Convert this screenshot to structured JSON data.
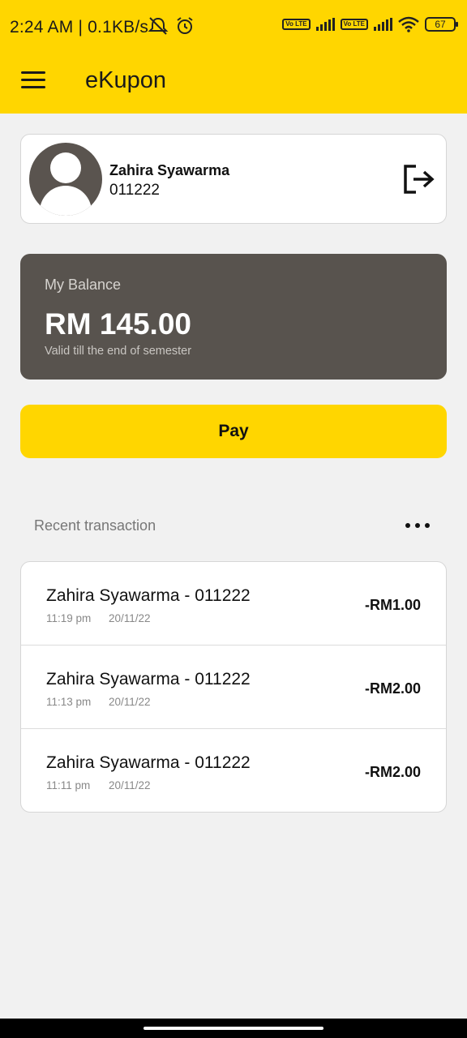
{
  "status_bar": {
    "time": "2:24 AM | 0.1KB/s",
    "network_type": "4G",
    "volte_label": "Vo LTE",
    "battery": "67"
  },
  "app_bar": {
    "title": "eKupon",
    "menu_icon": "hamburger-icon"
  },
  "profile": {
    "name": "Zahira Syawarma",
    "id": "011222",
    "logout_icon": "logout-icon"
  },
  "balance": {
    "label": "My Balance",
    "amount": "RM 145.00",
    "note": "Valid till the end of semester"
  },
  "pay_button": {
    "label": "Pay"
  },
  "recent": {
    "label": "Recent transaction",
    "more_icon": "more-horizontal-icon"
  },
  "transactions": [
    {
      "title": "Zahira Syawarma - 011222",
      "time": "11:19 pm",
      "date": "20/11/22",
      "amount": "-RM1.00"
    },
    {
      "title": "Zahira Syawarma - 011222",
      "time": "11:13 pm",
      "date": "20/11/22",
      "amount": "-RM2.00"
    },
    {
      "title": "Zahira Syawarma - 011222",
      "time": "11:11 pm",
      "date": "20/11/22",
      "amount": "-RM2.00"
    }
  ],
  "colors": {
    "accent": "#ffd600",
    "balance_card": "#58534e",
    "background": "#f1f1f1"
  }
}
